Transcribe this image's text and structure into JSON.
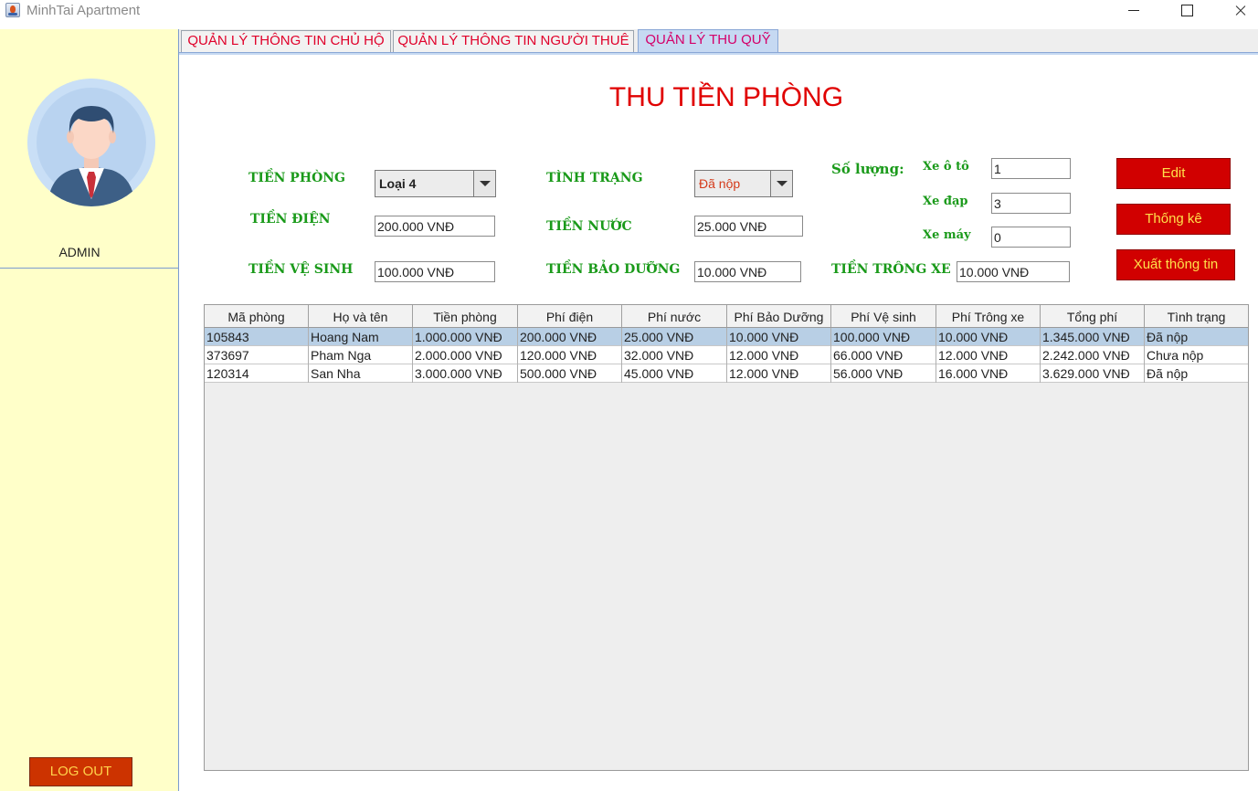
{
  "window": {
    "title": "MinhTai Apartment"
  },
  "sidebar": {
    "user_label": "ADMIN",
    "logout_label": "LOG OUT"
  },
  "tabs": [
    {
      "label": "QUẢN LÝ THÔNG TIN CHỦ HỘ",
      "active": false
    },
    {
      "label": "QUẢN LÝ THÔNG TIN NGƯỜI THUÊ",
      "active": false
    },
    {
      "label": "QUẢN LÝ THU QUỸ",
      "active": true
    }
  ],
  "page": {
    "title": "THU TIỀN PHÒNG"
  },
  "form": {
    "tien_phong": {
      "label": "TIỀN PHÒNG",
      "value": "Loại 4"
    },
    "tinh_trang": {
      "label": "TÌNH TRẠNG",
      "value": "Đã nộp"
    },
    "so_luong": {
      "label": "Số lượng:"
    },
    "xe_oto": {
      "label": "Xe ô tô",
      "value": "1"
    },
    "xe_dap": {
      "label": "Xe đạp",
      "value": "3"
    },
    "xe_may": {
      "label": "Xe máy",
      "value": "0"
    },
    "tien_dien": {
      "label": "TIỀN ĐIỆN",
      "value": "200.000 VNĐ"
    },
    "tien_nuoc": {
      "label": "TIỀN NƯỚC",
      "value": "25.000 VNĐ"
    },
    "tien_ve_sinh": {
      "label": "TIỀN VỆ SINH",
      "value": "100.000 VNĐ"
    },
    "tien_bao_duong": {
      "label": "TIỀN BẢO DƯỠNG",
      "value": "10.000 VNĐ"
    },
    "tien_trong_xe": {
      "label": "TIỀN TRÔNG XE",
      "value": "10.000 VNĐ"
    }
  },
  "buttons": {
    "edit": "Edit",
    "thong_ke": "Thống kê",
    "xuat_thong_tin": "Xuất thông tin"
  },
  "table": {
    "columns": [
      "Mã phòng",
      "Họ và tên",
      "Tiền phòng",
      "Phí điện",
      "Phí nước",
      "Phí Bảo Dưỡng",
      "Phí Vệ sinh",
      "Phí Trông xe",
      "Tổng phí",
      "Tình trạng"
    ],
    "rows": [
      [
        "105843",
        "Hoang Nam",
        "1.000.000 VNĐ",
        "200.000 VNĐ",
        "25.000 VNĐ",
        "10.000 VNĐ",
        "100.000 VNĐ",
        "10.000 VNĐ",
        "1.345.000 VNĐ",
        "Đã nộp"
      ],
      [
        "373697",
        "Pham Nga",
        "2.000.000 VNĐ",
        "120.000 VNĐ",
        "32.000 VNĐ",
        "12.000 VNĐ",
        "66.000 VNĐ",
        "12.000 VNĐ",
        "2.242.000 VNĐ",
        "Chưa nộp"
      ],
      [
        "120314",
        "San Nha",
        "3.000.000 VNĐ",
        "500.000 VNĐ",
        "45.000 VNĐ",
        "12.000 VNĐ",
        "56.000 VNĐ",
        "16.000 VNĐ",
        "3.629.000 VNĐ",
        "Đã nộp"
      ]
    ],
    "selected_row": 0
  },
  "colors": {
    "sidebar_bg": "#ffffc9",
    "title_red": "#e00000",
    "label_green": "#1a9a1a",
    "button_red": "#d10000",
    "button_text": "#ffe04a",
    "selected_row": "#b8cfe5"
  },
  "icons": {
    "app": "java-cup-icon",
    "avatar": "businessman-avatar-icon"
  }
}
